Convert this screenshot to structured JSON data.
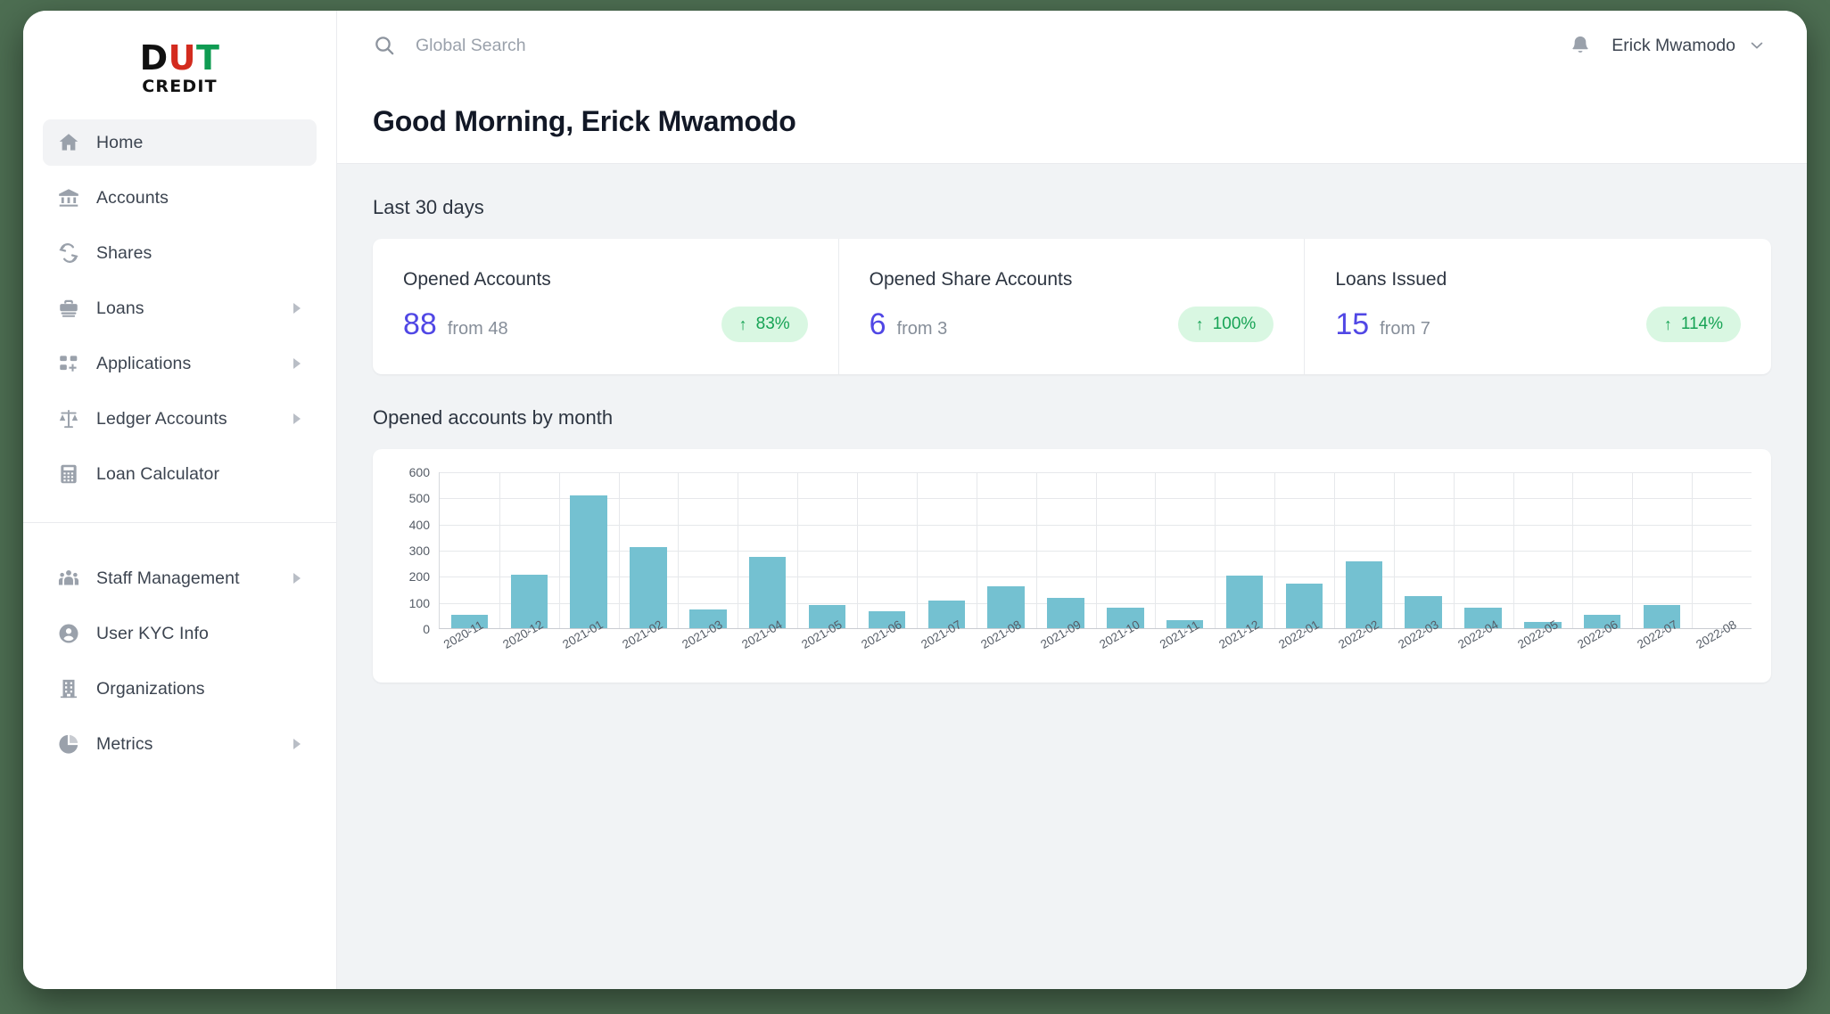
{
  "brand": {
    "logo_part1": "D",
    "logo_part2": "U",
    "logo_part3": "T",
    "logo_subtitle": "CREDIT",
    "colors": {
      "black": "#111111",
      "red": "#d32b1e",
      "green": "#0f9b52"
    }
  },
  "sidebar": {
    "items": [
      {
        "label": "Home",
        "icon": "home-icon",
        "active": true,
        "caret": false
      },
      {
        "label": "Accounts",
        "icon": "bank-icon",
        "active": false,
        "caret": false
      },
      {
        "label": "Shares",
        "icon": "refresh-icon",
        "active": false,
        "caret": false
      },
      {
        "label": "Loans",
        "icon": "briefcase-icon",
        "active": false,
        "caret": true
      },
      {
        "label": "Applications",
        "icon": "apps-add-icon",
        "active": false,
        "caret": true
      },
      {
        "label": "Ledger Accounts",
        "icon": "scales-icon",
        "active": false,
        "caret": true
      },
      {
        "label": "Loan Calculator",
        "icon": "calculator-icon",
        "active": false,
        "caret": false
      }
    ],
    "items_secondary": [
      {
        "label": "Staff Management",
        "icon": "people-icon",
        "active": false,
        "caret": true
      },
      {
        "label": "User KYC Info",
        "icon": "user-circle-icon",
        "active": false,
        "caret": false
      },
      {
        "label": "Organizations",
        "icon": "building-icon",
        "active": false,
        "caret": false
      },
      {
        "label": "Metrics",
        "icon": "pie-chart-icon",
        "active": false,
        "caret": true
      }
    ]
  },
  "topbar": {
    "search_placeholder": "Global Search",
    "search_value": "",
    "user_name": "Erick Mwamodo"
  },
  "page": {
    "greeting": "Good Morning, Erick Mwamodo",
    "section_stats_title": "Last 30 days",
    "section_chart_title": "Opened accounts by month"
  },
  "stats": [
    {
      "label": "Opened Accounts",
      "value": "88",
      "from": "from 48",
      "delta": "83%",
      "arrow": "↑"
    },
    {
      "label": "Opened Share Accounts",
      "value": "6",
      "from": "from 3",
      "delta": "100%",
      "arrow": "↑"
    },
    {
      "label": "Loans Issued",
      "value": "15",
      "from": "from 7",
      "delta": "114%",
      "arrow": "↑"
    }
  ],
  "theme": {
    "accent_value": "#5047e5",
    "badge_bg": "#d9f7e2",
    "badge_fg": "#17a355",
    "bar_color": "#74c1d1",
    "desktop_bg": "#4d6e52"
  },
  "chart_data": {
    "type": "bar",
    "title": "Opened accounts by month",
    "xlabel": "",
    "ylabel": "",
    "ylim": [
      0,
      600
    ],
    "yticks": [
      0,
      100,
      200,
      300,
      400,
      500,
      600
    ],
    "grid": true,
    "legend": null,
    "categories": [
      "2020-11",
      "2020-12",
      "2021-01",
      "2021-02",
      "2021-03",
      "2021-04",
      "2021-05",
      "2021-06",
      "2021-07",
      "2021-08",
      "2021-09",
      "2021-10",
      "2021-11",
      "2021-12",
      "2022-01",
      "2022-02",
      "2022-03",
      "2022-04",
      "2022-05",
      "2022-06",
      "2022-07",
      "2022-08"
    ],
    "values": [
      50,
      203,
      508,
      310,
      70,
      272,
      87,
      65,
      105,
      160,
      115,
      80,
      32,
      200,
      170,
      255,
      123,
      78,
      25,
      50,
      88,
      0
    ],
    "series": [
      {
        "name": "Opened accounts",
        "values": [
          50,
          203,
          508,
          310,
          70,
          272,
          87,
          65,
          105,
          160,
          115,
          80,
          32,
          200,
          170,
          255,
          123,
          78,
          25,
          50,
          88,
          0
        ]
      }
    ]
  }
}
